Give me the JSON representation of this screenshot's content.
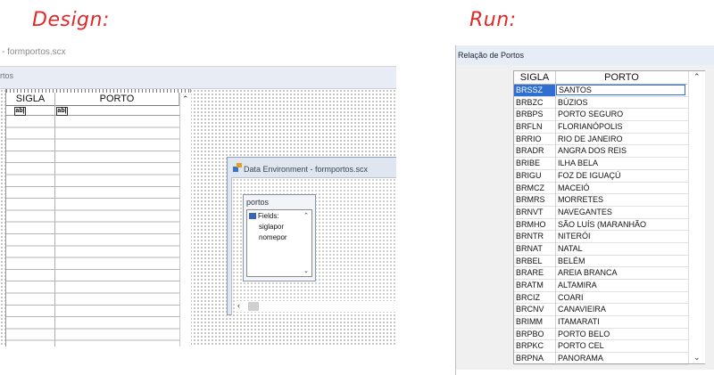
{
  "headings": {
    "design": "Design:",
    "run": "Run:"
  },
  "design": {
    "window_title": "- formportos.scx",
    "form_caption": "rtos",
    "grid": {
      "col1": "SIGLA",
      "col2": "PORTO",
      "ab1": "ab|",
      "ab2": "ab|"
    },
    "data_environment": {
      "title": "Data Environment - formportos.scx",
      "table_name": "portos",
      "fields_label": "Fields:",
      "fields": [
        "siglapor",
        "nomepor"
      ]
    }
  },
  "run": {
    "window_title": "Relação de Portos",
    "columns": [
      "SIGLA",
      "PORTO"
    ],
    "rows": [
      {
        "sigla": "BRSSZ",
        "porto": "SANTOS"
      },
      {
        "sigla": "BRBZC",
        "porto": "BÚZIOS"
      },
      {
        "sigla": "BRBPS",
        "porto": "PORTO SEGURO"
      },
      {
        "sigla": "BRFLN",
        "porto": "FLORIANÓPOLIS"
      },
      {
        "sigla": "BRRIO",
        "porto": "RIO DE JANEIRO"
      },
      {
        "sigla": "BRADR",
        "porto": "ANGRA DOS REIS"
      },
      {
        "sigla": "BRIBE",
        "porto": "ILHA BELA"
      },
      {
        "sigla": "BRIGU",
        "porto": "FOZ DE IGUAÇÚ"
      },
      {
        "sigla": "BRMCZ",
        "porto": "MACEIÓ"
      },
      {
        "sigla": "BRMRS",
        "porto": "MORRETES"
      },
      {
        "sigla": "BRNVT",
        "porto": "NAVEGANTES"
      },
      {
        "sigla": "BRMHO",
        "porto": "SÃO LUÍS (MARANHÃO"
      },
      {
        "sigla": "BRNTR",
        "porto": "NITERÓI"
      },
      {
        "sigla": "BRNAT",
        "porto": "NATAL"
      },
      {
        "sigla": "BRBEL",
        "porto": "BELÉM"
      },
      {
        "sigla": "BRARE",
        "porto": "AREIA BRANCA"
      },
      {
        "sigla": "BRATM",
        "porto": "ALTAMIRA"
      },
      {
        "sigla": "BRCIZ",
        "porto": "COARI"
      },
      {
        "sigla": "BRCNV",
        "porto": "CANAVIEIRA"
      },
      {
        "sigla": "BRIMM",
        "porto": "ITAMARATI"
      },
      {
        "sigla": "BRPBO",
        "porto": "PORTO BELO"
      },
      {
        "sigla": "BRPKC",
        "porto": "PORTO CEL"
      },
      {
        "sigla": "BRPNA",
        "porto": "PANORAMA"
      }
    ],
    "selected_index": 0
  },
  "icons": {
    "scroll_up": "chevron-up-icon",
    "scroll_down": "chevron-down-icon",
    "scroll_left": "chevron-left-icon",
    "data_env": "data-environment-icon",
    "fields": "fields-icon"
  },
  "colors": {
    "heading": "#e02828",
    "selection": "#2e6fd1"
  }
}
